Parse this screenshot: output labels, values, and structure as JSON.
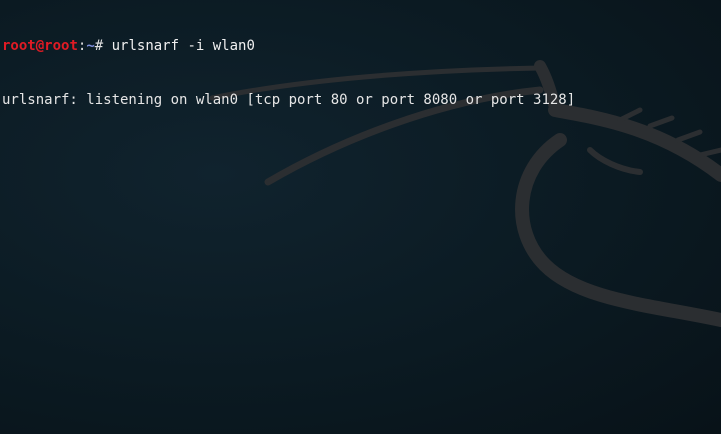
{
  "terminal": {
    "prompt": {
      "user": "root",
      "at": "@",
      "host": "root",
      "separator": ":",
      "path": "~",
      "symbol": "# "
    },
    "command": "urlsnarf -i wlan0",
    "output": [
      "urlsnarf: listening on wlan0 [tcp port 80 or port 8080 or port 3128]"
    ]
  },
  "colors": {
    "background": "#0b1a22",
    "prompt_user": "#e01b24",
    "text": "#e0e0e0",
    "dragon": "#2b2e31"
  },
  "icons": {
    "wallpaper": "kali-dragon-icon"
  }
}
